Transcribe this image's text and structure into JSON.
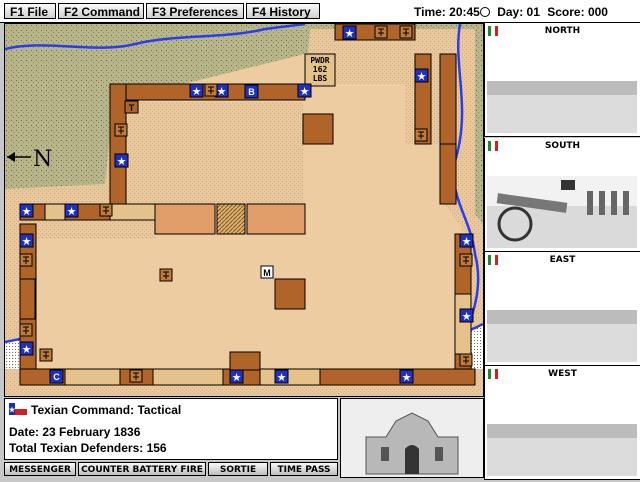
{
  "menu": {
    "items": [
      {
        "key": "file",
        "label": "F1 File"
      },
      {
        "key": "command",
        "label": "F2 Command"
      },
      {
        "key": "preferences",
        "label": "F3 Preferences"
      },
      {
        "key": "history",
        "label": "F4 History"
      }
    ]
  },
  "status": {
    "time_label": "Time:",
    "time": "20:45",
    "day_label": "Day:",
    "day": "01",
    "score_label": "Score:",
    "score": "000"
  },
  "map": {
    "compass_letter": "N",
    "powder_label": [
      "PWDR",
      "162",
      "LBS"
    ],
    "bastion_labels": [
      "T",
      "B",
      "C"
    ],
    "marker_label": "M",
    "colors": {
      "sand": "#e8c89c",
      "fort_wall": "#b0642a",
      "river": "#2a3cf0",
      "grass": "#a7b07a",
      "building": "#e19d6a"
    }
  },
  "views": [
    {
      "label": "NORTH",
      "scene": "empty-landscape"
    },
    {
      "label": "SOUTH",
      "scene": "cannon-and-soldiers"
    },
    {
      "label": "EAST",
      "scene": "empty-landscape"
    },
    {
      "label": "WEST",
      "scene": "empty-landscape"
    }
  ],
  "command": {
    "title": "Texian Command: Tactical",
    "date": "Date: 23 February 1836",
    "defenders": "Total Texian Defenders: 156"
  },
  "actions": [
    "MESSENGER",
    "COUNTER BATTERY FIRE",
    "SORTIE",
    "TIME PASS"
  ]
}
